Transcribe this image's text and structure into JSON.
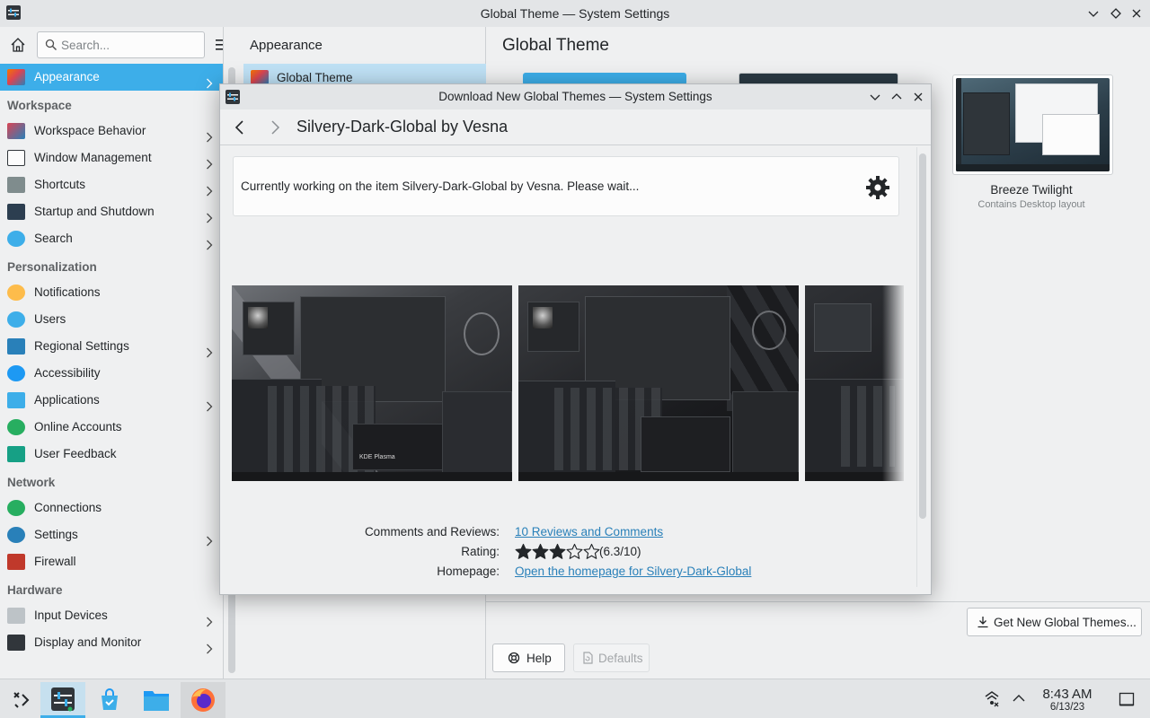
{
  "window": {
    "title": "Global Theme — System Settings"
  },
  "sidebar": {
    "search_placeholder": "Search...",
    "items": [
      {
        "label": "Appearance",
        "active": true,
        "chevron": true,
        "icon": "appearance-icon"
      },
      {
        "header": "Workspace"
      },
      {
        "label": "Workspace Behavior",
        "chevron": true,
        "icon": "workspace-behavior-icon"
      },
      {
        "label": "Window Management",
        "chevron": true,
        "icon": "window-management-icon"
      },
      {
        "label": "Shortcuts",
        "chevron": true,
        "icon": "keyboard-icon"
      },
      {
        "label": "Startup and Shutdown",
        "chevron": true,
        "icon": "startup-icon"
      },
      {
        "label": "Search",
        "chevron": true,
        "icon": "search-globe-icon"
      },
      {
        "header": "Personalization"
      },
      {
        "label": "Notifications",
        "chevron": false,
        "icon": "bell-icon"
      },
      {
        "label": "Users",
        "chevron": false,
        "icon": "users-icon"
      },
      {
        "label": "Regional Settings",
        "chevron": true,
        "icon": "regional-icon"
      },
      {
        "label": "Accessibility",
        "chevron": false,
        "icon": "accessibility-icon"
      },
      {
        "label": "Applications",
        "chevron": true,
        "icon": "applications-icon"
      },
      {
        "label": "Online Accounts",
        "chevron": false,
        "icon": "online-accounts-icon"
      },
      {
        "label": "User Feedback",
        "chevron": false,
        "icon": "feedback-icon"
      },
      {
        "header": "Network"
      },
      {
        "label": "Connections",
        "chevron": false,
        "icon": "connections-icon"
      },
      {
        "label": "Settings",
        "chevron": true,
        "icon": "network-settings-icon"
      },
      {
        "label": "Firewall",
        "chevron": false,
        "icon": "firewall-icon"
      },
      {
        "header": "Hardware"
      },
      {
        "label": "Input Devices",
        "chevron": true,
        "icon": "mouse-icon"
      },
      {
        "label": "Display and Monitor",
        "chevron": true,
        "icon": "monitor-icon"
      }
    ]
  },
  "middle": {
    "heading": "Appearance",
    "selected_item": "Global Theme"
  },
  "main": {
    "heading": "Global Theme",
    "theme_card": {
      "name": "Breeze Twilight",
      "subtitle": "Contains Desktop layout"
    },
    "get_new_button": "Get New Global Themes...",
    "help_button": "Help",
    "defaults_button": "Defaults"
  },
  "dialog": {
    "title": "Download New Global Themes — System Settings",
    "heading": "Silvery-Dark-Global by Vesna",
    "status_text": "Currently working on the item Silvery-Dark-Global by Vesna. Please wait...",
    "comments_label": "Comments and Reviews:",
    "comments_link": "10 Reviews and Comments",
    "rating_label": "Rating:",
    "rating_value": "(6.3/10)",
    "rating_stars": 3,
    "homepage_label": "Homepage:",
    "homepage_link": "Open the homepage for Silvery-Dark-Global",
    "screenshot_caption": "KDE Plasma"
  },
  "taskbar": {
    "time": "8:43 AM",
    "date": "6/13/23"
  },
  "colors": {
    "accent": "#3daee9",
    "selection": "#bfe1f5",
    "link": "#2980b9",
    "background": "#eff0f1"
  }
}
